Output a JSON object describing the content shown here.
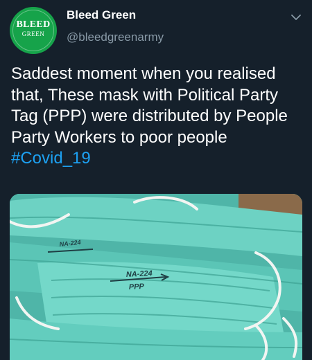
{
  "account": {
    "avatar_line1": "BLEED",
    "avatar_line2": "GREEN",
    "display_name": "Bleed Green",
    "handle": "@bleedgreenarmy"
  },
  "menu": {
    "icon": "chevron-down-icon"
  },
  "tweet": {
    "text": "Saddest moment when you realised that, These mask with Political Party Tag (PPP) were distributed by People Party Workers to poor people ",
    "hashtag": "#Covid_19"
  },
  "media": {
    "mask_labels": {
      "tag_top": "NA-224",
      "tag_main": "NA-224",
      "party": "PPP"
    }
  },
  "colors": {
    "background": "#15202b",
    "secondary_text": "#8899a6",
    "link": "#1da1f2",
    "avatar": "#16a34a",
    "mask": "#5ec8ba"
  }
}
